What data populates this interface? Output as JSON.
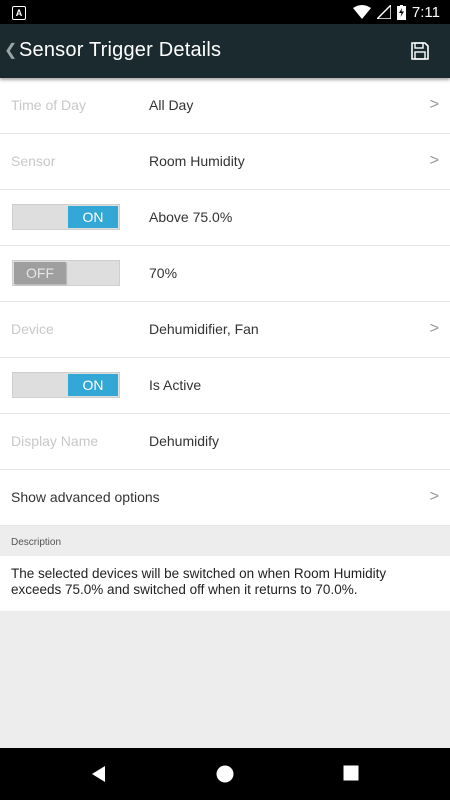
{
  "status_bar": {
    "left_icon_label": "A",
    "time": "7:11",
    "icons": [
      "wifi-icon",
      "cell-signal-icon",
      "battery-charging-icon"
    ]
  },
  "app_bar": {
    "title": "Sensor Trigger Details",
    "back_icon": "chevron-left-icon",
    "save_icon": "save-icon",
    "colors": {
      "background": "#1b2a2f",
      "text": "#ffffff"
    }
  },
  "rows": {
    "time_of_day": {
      "label": "Time of Day",
      "value": "All Day",
      "chevron": ">"
    },
    "sensor": {
      "label": "Sensor",
      "value": "Room Humidity",
      "chevron": ">"
    },
    "above": {
      "toggle_text": "ON",
      "toggle_state": "on",
      "value": "Above 75.0%"
    },
    "below": {
      "toggle_text": "OFF",
      "toggle_state": "off",
      "value": "70%"
    },
    "device": {
      "label": "Device",
      "value": "Dehumidifier, Fan",
      "chevron": ">"
    },
    "active": {
      "toggle_text": "ON",
      "toggle_state": "on",
      "value": "Is Active"
    },
    "display_name": {
      "label": "Display Name",
      "value": "Dehumidify"
    },
    "advanced": {
      "label": "Show advanced options",
      "chevron": ">"
    }
  },
  "description": {
    "header": "Description",
    "text": "The selected devices will be switched on when Room Humidity exceeds 75.0% and switched off when it returns to 70.0%."
  },
  "colors": {
    "toggle_on": "#33a7d6",
    "toggle_off": "#9f9f9f",
    "background": "#ededed"
  },
  "nav_bar": {
    "icons": [
      "back-triangle-icon",
      "home-circle-icon",
      "recents-square-icon"
    ]
  }
}
